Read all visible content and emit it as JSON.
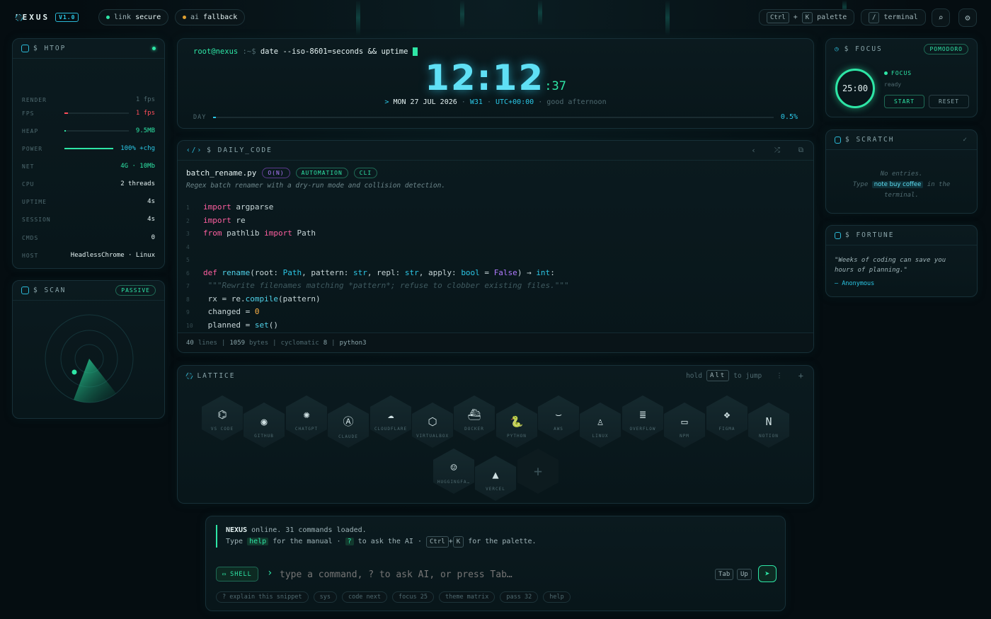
{
  "topbar": {
    "brand": "NEXUS",
    "version": "V1.0",
    "link_label": "link",
    "link_value": "secure",
    "ai_label": "ai",
    "ai_value": "fallback",
    "palette_key1": "Ctrl",
    "palette_plus": "+",
    "palette_key2": "K",
    "palette_label": "palette",
    "terminal_key": "/",
    "terminal_label": "terminal"
  },
  "htop": {
    "title": "$ HTOP",
    "rows": [
      {
        "k": "RENDER",
        "v": "1 fps"
      },
      {
        "k": "FPS",
        "v": "1 fps"
      },
      {
        "k": "HEAP",
        "v": "9.5MB"
      },
      {
        "k": "POWER",
        "v": "100% +chg"
      },
      {
        "k": "NET",
        "v": "4G · 10Mb"
      },
      {
        "k": "CPU",
        "v": "2 threads"
      },
      {
        "k": "UPTIME",
        "v": "4s"
      },
      {
        "k": "SESSION",
        "v": "4s"
      },
      {
        "k": "CMDS",
        "v": "0"
      },
      {
        "k": "HOST",
        "v": "HeadlessChrome · Linux"
      }
    ],
    "fps_level": 0.06,
    "heap_level": 0.01,
    "power_level": 1.0
  },
  "scan": {
    "title": "$ SCAN",
    "badge": "PASSIVE"
  },
  "clock": {
    "prompt_user": "root@nexus",
    "prompt_path": ":~$",
    "command": "date --iso-8601=seconds && uptime",
    "time": "12:12",
    "seconds": ":37",
    "date_arrow": ">",
    "date": "MON 27 JUL 2026",
    "week": "W31",
    "tz": "UTC+00:00",
    "greeting": "good afternoon",
    "day_label": "DAY",
    "day_pct": "0.5%",
    "day_level": 0.005
  },
  "daily_code": {
    "title": "$ DAILY_CODE",
    "filename": "batch_rename.py",
    "tags": [
      "O(N)",
      "AUTOMATION",
      "CLI"
    ],
    "description": "Regex batch renamer with a dry-run mode and collision detection.",
    "footer": {
      "lines": "40",
      "lines_label": "lines",
      "bytes": "1059",
      "bytes_label": "bytes",
      "cyc_label": "cyclomatic",
      "cyc": "8",
      "lang": "python3"
    }
  },
  "lattice": {
    "title": "$ LATTICE",
    "hint_pre": "hold",
    "hint_key": "Alt",
    "hint_post": "to jump",
    "tiles": [
      {
        "label": "VS CODE",
        "icon": "vscode-icon",
        "glyph": "⌬"
      },
      {
        "label": "GITHUB",
        "icon": "github-icon",
        "glyph": "◉"
      },
      {
        "label": "CHATGPT",
        "icon": "chatgpt-icon",
        "glyph": "✺"
      },
      {
        "label": "CLAUDE",
        "icon": "claude-icon",
        "glyph": "Ⓐ"
      },
      {
        "label": "CLOUDFLARE",
        "icon": "cloudflare-icon",
        "glyph": "☁"
      },
      {
        "label": "VIRTUALBOX",
        "icon": "virtualbox-icon",
        "glyph": "⬡"
      },
      {
        "label": "DOCKER",
        "icon": "docker-icon",
        "glyph": "⛴"
      },
      {
        "label": "PYTHON",
        "icon": "python-icon",
        "glyph": "🐍"
      },
      {
        "label": "AWS",
        "icon": "aws-icon",
        "glyph": "⌣"
      },
      {
        "label": "LINUX",
        "icon": "linux-icon",
        "glyph": "♙"
      },
      {
        "label": "OVERFLOW",
        "icon": "stackoverflow-icon",
        "glyph": "≣"
      },
      {
        "label": "NPM",
        "icon": "npm-icon",
        "glyph": "▭"
      },
      {
        "label": "FIGMA",
        "icon": "figma-icon",
        "glyph": "❖"
      },
      {
        "label": "NOTION",
        "icon": "notion-icon",
        "glyph": "N"
      },
      {
        "label": "HUGGINGFA…",
        "icon": "huggingface-icon",
        "glyph": "☺"
      },
      {
        "label": "VERCEL",
        "icon": "vercel-icon",
        "glyph": "▲"
      }
    ],
    "add": "+"
  },
  "focus": {
    "title": "$ FOCUS",
    "badge": "POMODORO",
    "timer": "25:00",
    "status": "FOCUS",
    "sub": "ready",
    "start": "START",
    "reset": "RESET"
  },
  "scratch": {
    "title": "$ SCRATCH",
    "empty": "No entries.",
    "hint_pre": "Type",
    "hint_cmd": "note buy coffee",
    "hint_post": "in the terminal."
  },
  "fortune": {
    "title": "$ FORTUNE",
    "quote": "\"Weeks of coding can save you hours of planning.\"",
    "author": "— Anonymous"
  },
  "shell": {
    "brand": "NEXUS",
    "line1": "online. 31 commands loaded.",
    "line2_pre": "Type",
    "help": "help",
    "line2_mid": "for the manual ·",
    "q": "?",
    "line2_mid2": "to ask the AI ·",
    "k1": "Ctrl",
    "plus": "+",
    "k2": "K",
    "line2_post": "for the palette.",
    "mode": "SHELL",
    "placeholder": "type a command, ? to ask AI, or press Tab…",
    "tab": "Tab",
    "up": "Up",
    "chips": [
      "? explain this snippet",
      "sys",
      "code next",
      "focus 25",
      "theme matrix",
      "pass 32",
      "help"
    ]
  }
}
